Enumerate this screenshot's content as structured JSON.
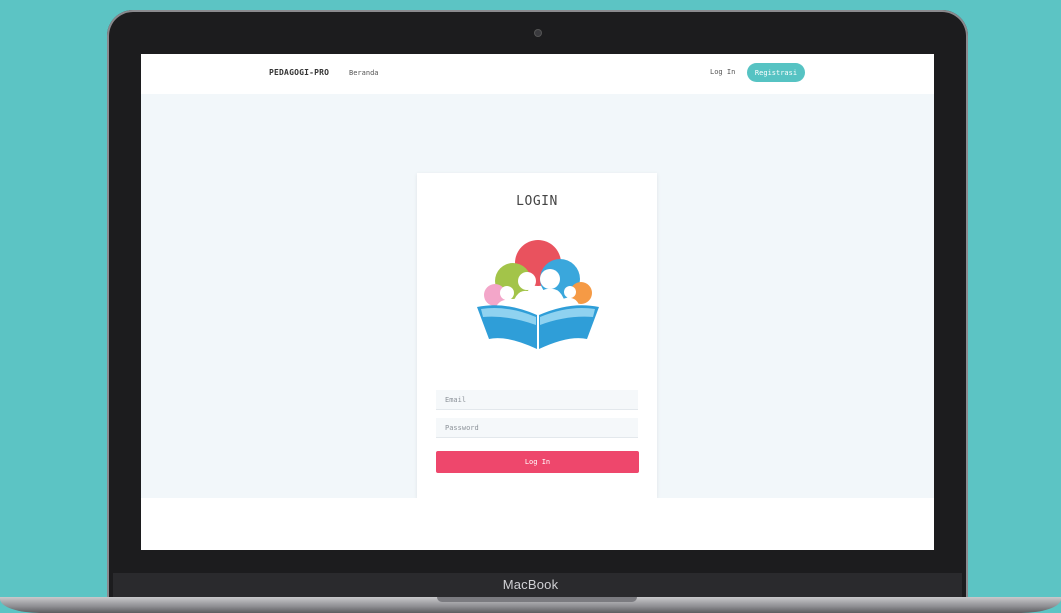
{
  "device": {
    "label": "MacBook"
  },
  "navbar": {
    "brand": "PEDAGOGI-PRO",
    "home_link": "Beranda",
    "login_link": "Log In",
    "register_button": "Registrasi"
  },
  "login_card": {
    "title": "LOGIN",
    "logo_icon": "people-reading-book-logo",
    "email_placeholder": "Email",
    "password_placeholder": "Password",
    "submit_label": "Log In"
  },
  "colors": {
    "background": "#5cc4c4",
    "accent_teal": "#56c3c3",
    "button_pink": "#ee476c",
    "page_background": "#f2f7fa"
  }
}
